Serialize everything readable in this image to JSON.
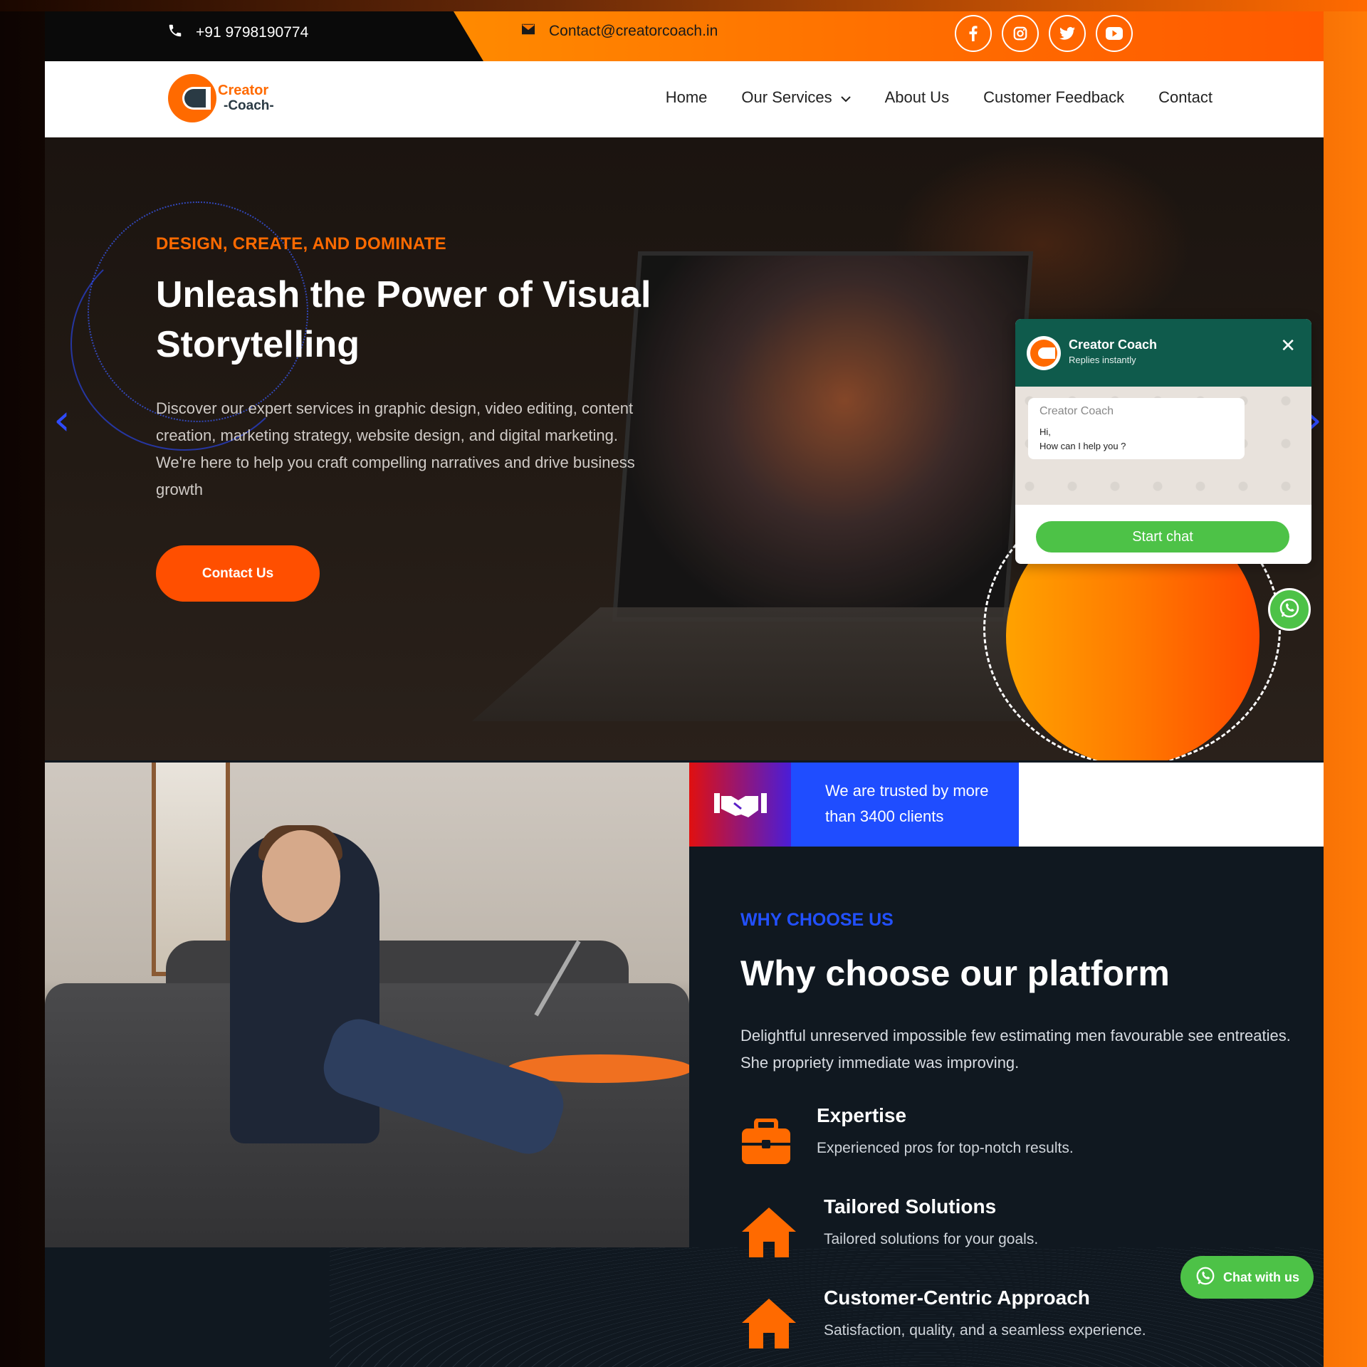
{
  "topbar": {
    "phone": "+91 9798190774",
    "email": "Contact@creatorcoach.in",
    "socials": [
      "facebook-icon",
      "instagram-icon",
      "twitter-icon",
      "youtube-icon"
    ]
  },
  "brand": {
    "line1": "Creator",
    "line2": "-Coach-",
    "color": "#ff6a00"
  },
  "nav": {
    "items": [
      "Home",
      "Our Services",
      "About Us",
      "Customer Feedback",
      "Contact"
    ]
  },
  "hero": {
    "kicker": "DESIGN, CREATE, AND DOMINATE",
    "title": "Unleash the Power of Visual Storytelling",
    "text": "Discover our expert services in graphic design, video editing, content creation, marketing strategy, website design, and digital marketing. We're here to help you craft compelling narratives and drive business growth",
    "button": "Contact Us"
  },
  "chat_popup": {
    "name": "Creator Coach",
    "status": "Replies instantly",
    "bubble_name": "Creator Coach",
    "bubble_line1": "Hi,",
    "bubble_line2": "How can I help you ?",
    "start_button": "Start chat"
  },
  "trusted": {
    "text": "We are trusted by more than 3400 clients"
  },
  "why": {
    "kicker": "WHY CHOOSE US",
    "title": "Why choose our platform",
    "text": "Delightful unreserved impossible few estimating men favourable see entreaties. She propriety immediate was improving.",
    "features": [
      {
        "icon": "briefcase-icon",
        "title": "Expertise",
        "desc": "Experienced pros for top-notch results."
      },
      {
        "icon": "home-icon",
        "title": "Tailored Solutions",
        "desc": "Tailored solutions for your goals."
      },
      {
        "icon": "home-icon",
        "title": "Customer-Centric Approach",
        "desc": "Satisfaction, quality, and a seamless experience."
      }
    ]
  },
  "chat_pill": {
    "label": "Chat with us"
  },
  "colors": {
    "accent": "#ff6a00",
    "blue": "#1f4dff",
    "whatsapp": "#4dc247",
    "dark": "#101820"
  }
}
